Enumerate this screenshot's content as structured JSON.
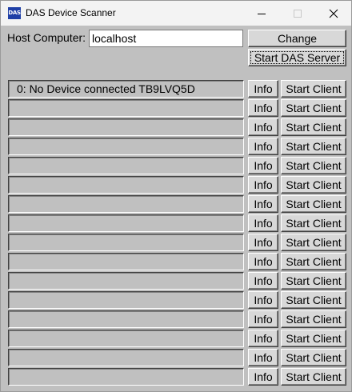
{
  "window": {
    "title": "DAS Device Scanner",
    "icon_name": "das-app-icon",
    "icon_text": "DAS"
  },
  "host": {
    "label": "Host Computer:",
    "value": "localhost",
    "change_label": "Change",
    "start_server_label": "Start DAS Server"
  },
  "devices": [
    {
      "text": "0: No Device connected TB9LVQ5D",
      "info_label": "Info",
      "client_label": "Start Client"
    },
    {
      "text": "",
      "info_label": "Info",
      "client_label": "Start Client"
    },
    {
      "text": "",
      "info_label": "Info",
      "client_label": "Start Client"
    },
    {
      "text": "",
      "info_label": "Info",
      "client_label": "Start Client"
    },
    {
      "text": "",
      "info_label": "Info",
      "client_label": "Start Client"
    },
    {
      "text": "",
      "info_label": "Info",
      "client_label": "Start Client"
    },
    {
      "text": "",
      "info_label": "Info",
      "client_label": "Start Client"
    },
    {
      "text": "",
      "info_label": "Info",
      "client_label": "Start Client"
    },
    {
      "text": "",
      "info_label": "Info",
      "client_label": "Start Client"
    },
    {
      "text": "",
      "info_label": "Info",
      "client_label": "Start Client"
    },
    {
      "text": "",
      "info_label": "Info",
      "client_label": "Start Client"
    },
    {
      "text": "",
      "info_label": "Info",
      "client_label": "Start Client"
    },
    {
      "text": "",
      "info_label": "Info",
      "client_label": "Start Client"
    },
    {
      "text": "",
      "info_label": "Info",
      "client_label": "Start Client"
    },
    {
      "text": "",
      "info_label": "Info",
      "client_label": "Start Client"
    },
    {
      "text": "",
      "info_label": "Info",
      "client_label": "Start Client"
    }
  ]
}
